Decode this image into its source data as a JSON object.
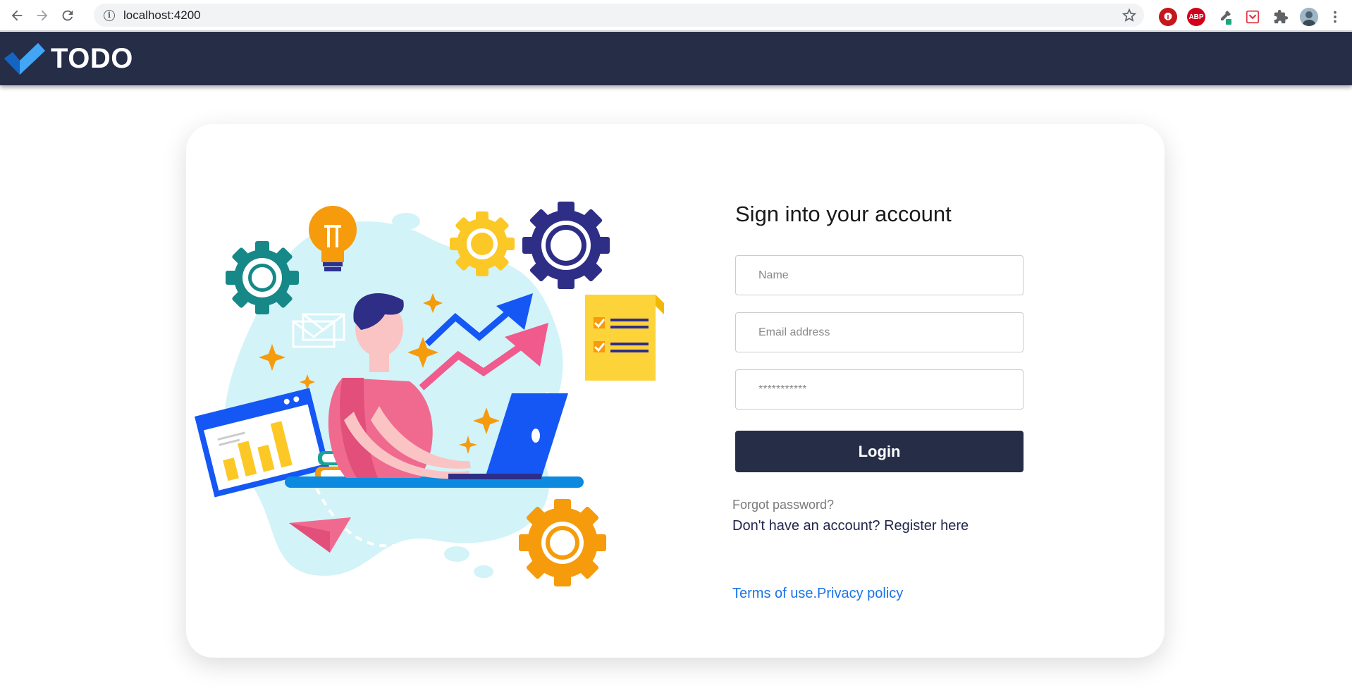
{
  "browser": {
    "url": "localhost:4200",
    "back_icon": "back-arrow-icon",
    "forward_icon": "forward-arrow-icon",
    "reload_icon": "reload-icon",
    "extensions": [
      {
        "name": "ublock-icon",
        "label": "",
        "color": "#c4161c"
      },
      {
        "name": "adblock-plus-icon",
        "label": "ABP",
        "color": "#d0021b"
      },
      {
        "name": "eyedropper-icon",
        "label": "",
        "color": "#1aa77a"
      },
      {
        "name": "pocket-icon",
        "label": "",
        "color": "#e03a47"
      },
      {
        "name": "puzzle-icon",
        "label": "",
        "color": "#5f6368"
      }
    ]
  },
  "header": {
    "brand": "TODO",
    "brand_color": "#262d47",
    "logo_icon": "checkmark-logo-icon"
  },
  "form": {
    "title": "Sign into your account",
    "name_placeholder": "Name",
    "email_placeholder": "Email address",
    "password_placeholder": "***********",
    "login_label": "Login",
    "forgot_label": "Forgot password?",
    "register_label": "Don't have an account? Register here",
    "terms_label": "Terms of use.",
    "privacy_label": "Privacy policy"
  },
  "colors": {
    "accent": "#262d47",
    "link": "#1a73e8"
  }
}
